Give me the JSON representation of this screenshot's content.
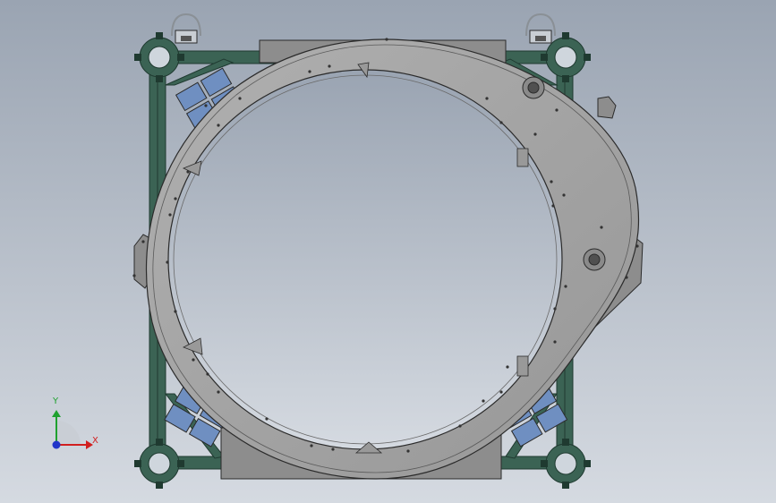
{
  "viewport": {
    "background_top": "#9aa4b2",
    "background_bottom": "#d5dae1"
  },
  "colors": {
    "frame_green": "#3b6354",
    "frame_green_dark": "#1f3a30",
    "plate_gray": "#8d8d8d",
    "plate_gray_dark": "#6f6f6f",
    "ring_gray": "#a5a5a5",
    "ring_gray_light": "#b6b6b6",
    "pad_blue": "#6f8fc1",
    "edge_dark": "#2b2b2b",
    "hole_dark": "#333333"
  },
  "triad": {
    "x_label": "X",
    "y_label": "Y",
    "x_color": "#d11f1f",
    "y_color": "#1fa12f",
    "z_color": "#2135c9"
  }
}
